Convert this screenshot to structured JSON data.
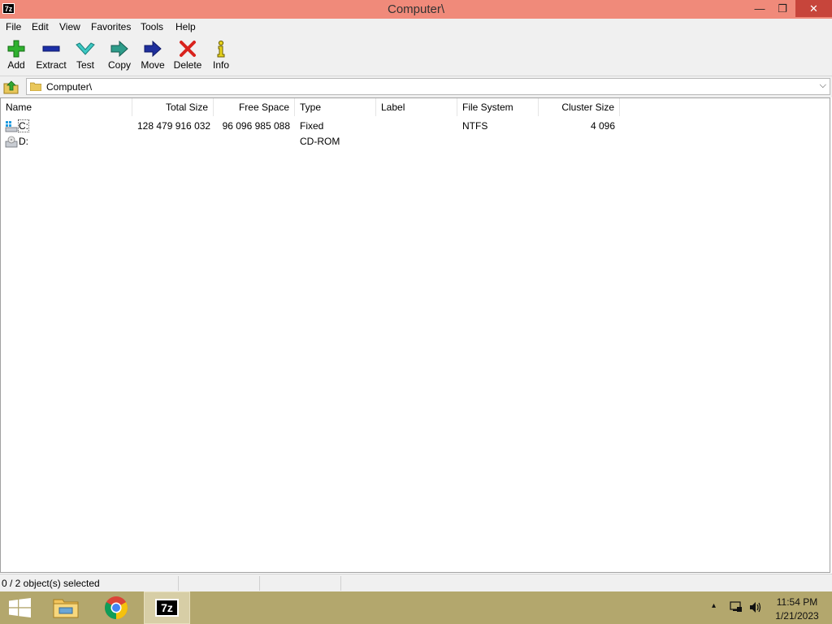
{
  "window": {
    "title": "Computer\\",
    "app_icon_text": "7z",
    "controls": {
      "minimize": "—",
      "restore": "❐",
      "close": "✕"
    }
  },
  "menu": [
    "File",
    "Edit",
    "View",
    "Favorites",
    "Tools",
    "Help"
  ],
  "toolbar": {
    "add": "Add",
    "extract": "Extract",
    "test": "Test",
    "copy": "Copy",
    "move": "Move",
    "delete": "Delete",
    "info": "Info"
  },
  "address": {
    "path": "Computer\\",
    "dropdown": "⌵"
  },
  "columns": {
    "name": "Name",
    "total_size": "Total Size",
    "free_space": "Free Space",
    "type": "Type",
    "label": "Label",
    "file_system": "File System",
    "cluster_size": "Cluster Size"
  },
  "rows": [
    {
      "name": "C:",
      "total_size": "128 479 916 032",
      "free_space": "96 096 985 088",
      "type": "Fixed",
      "label": "",
      "file_system": "NTFS",
      "cluster_size": "4 096",
      "icon": "hard-drive-icon"
    },
    {
      "name": "D:",
      "total_size": "",
      "free_space": "",
      "type": "CD-ROM",
      "label": "",
      "file_system": "",
      "cluster_size": "",
      "icon": "cd-drive-icon"
    }
  ],
  "status": {
    "selection": "0 / 2 object(s) selected",
    "pane2": "",
    "pane3": "",
    "pane4": ""
  },
  "taskbar": {
    "time": "11:54 PM",
    "date": "1/21/2023",
    "active_app_text": "7z",
    "tray_chevron": "▴"
  },
  "colors": {
    "titlebar": "#f08a7a",
    "close_button": "#c7453b",
    "taskbar": "#b3a76d"
  }
}
